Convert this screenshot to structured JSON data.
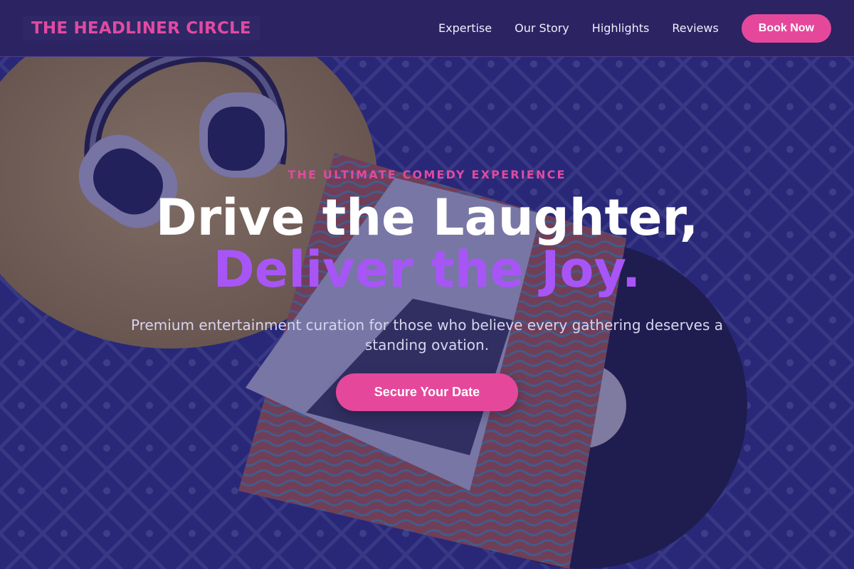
{
  "brand": {
    "name": "THE HEADLINER CIRCLE"
  },
  "nav": {
    "links": [
      "Expertise",
      "Our Story",
      "Highlights",
      "Reviews"
    ],
    "cta": "Book Now"
  },
  "hero": {
    "eyebrow": "THE ULTIMATE COMEDY EXPERIENCE",
    "headline_line1": "Drive the Laughter,",
    "headline_line2": "Deliver the Joy.",
    "subtext": "Premium entertainment curation for those who believe every gathering deserves a standing ovation.",
    "cta": "Secure Your Date",
    "background_image": "headphones-and-vinyl-record-photo"
  },
  "colors": {
    "accent_pink": "#e5489b",
    "accent_purple": "#a855f7",
    "navbar_bg": "#2b2362"
  }
}
